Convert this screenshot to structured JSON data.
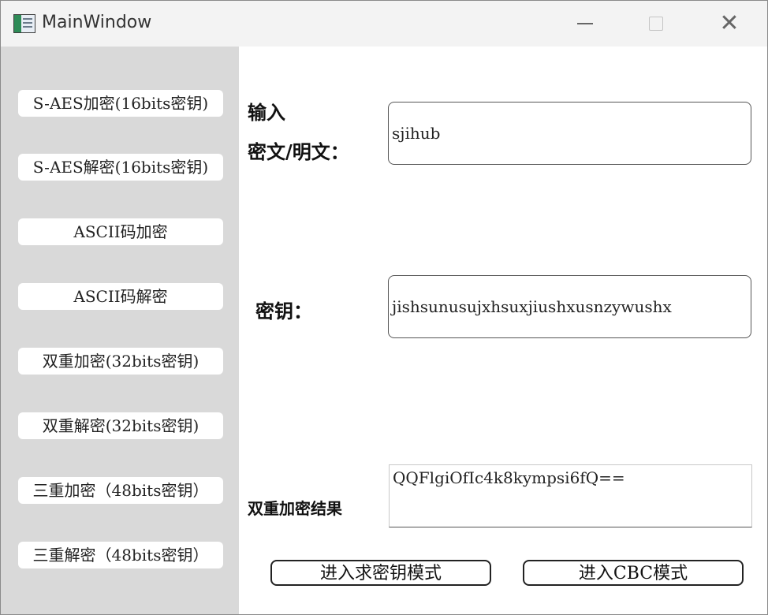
{
  "window": {
    "title": "MainWindow",
    "icons": {
      "app": "app-window-icon",
      "minimize": "minimize-icon",
      "maximize": "maximize-icon",
      "close": "close-icon",
      "close_glyph": "✕"
    }
  },
  "sidebar": {
    "items": [
      {
        "label": "S-AES加密(16bits密钥)"
      },
      {
        "label": "S-AES解密(16bits密钥)"
      },
      {
        "label": "ASCII码加密"
      },
      {
        "label": "ASCII码解密"
      },
      {
        "label": "双重加密(32bits密钥)"
      },
      {
        "label": "双重解密(32bits密钥)"
      },
      {
        "label": "三重加密（48bits密钥）"
      },
      {
        "label": "三重解密（48bits密钥）"
      }
    ]
  },
  "main": {
    "input_label_line1": "输入",
    "input_label_line2": "密文/明文：",
    "input_value": "sjihub",
    "key_label": "密钥：",
    "key_value": "jishsunusujxhsuxjiushxusnzywushx",
    "result_label": "双重加密结果",
    "result_value": "QQFlgiOfIc4k8kympsi6fQ==",
    "key_mode_button": "进入求密钥模式",
    "cbc_mode_button": "进入CBC模式"
  }
}
